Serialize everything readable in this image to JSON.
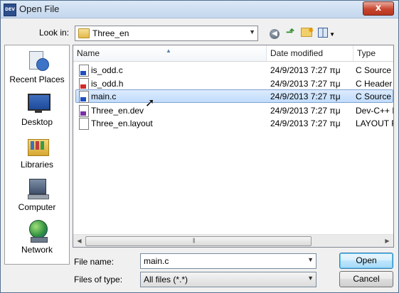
{
  "window": {
    "title": "Open File",
    "app_icon_text": "DEV",
    "close_label": "x"
  },
  "lookin": {
    "label": "Look in:",
    "value": "Three_en"
  },
  "places": [
    {
      "label": "Recent Places",
      "icon": "recent-places-icon"
    },
    {
      "label": "Desktop",
      "icon": "desktop-icon"
    },
    {
      "label": "Libraries",
      "icon": "libraries-icon"
    },
    {
      "label": "Computer",
      "icon": "computer-icon"
    },
    {
      "label": "Network",
      "icon": "network-icon"
    }
  ],
  "columns": {
    "name": "Name",
    "date": "Date modified",
    "type": "Type"
  },
  "files": [
    {
      "name": "is_odd.c",
      "date": "24/9/2013 7:27 πμ",
      "type": "C Source File",
      "icon": "c-source-icon",
      "badge_color": "#1f4fbf",
      "selected": false
    },
    {
      "name": "is_odd.h",
      "date": "24/9/2013 7:27 πμ",
      "type": "C Header File",
      "icon": "c-header-icon",
      "badge_color": "#d22a2a",
      "selected": false
    },
    {
      "name": "main.c",
      "date": "24/9/2013 7:27 πμ",
      "type": "C Source File",
      "icon": "c-source-icon",
      "badge_color": "#1f4fbf",
      "selected": true
    },
    {
      "name": "Three_en.dev",
      "date": "24/9/2013 7:27 πμ",
      "type": "Dev-C++ Project",
      "icon": "dev-project-icon",
      "badge_color": "#7b2fa8",
      "selected": false
    },
    {
      "name": "Three_en.layout",
      "date": "24/9/2013 7:27 πμ",
      "type": "LAYOUT File",
      "icon": "document-icon",
      "badge_color": "",
      "selected": false
    }
  ],
  "file_name": {
    "label": "File name:",
    "value": "main.c"
  },
  "file_type": {
    "label": "Files of type:",
    "value": "All files (*.*)"
  },
  "buttons": {
    "open": "Open",
    "cancel": "Cancel"
  }
}
